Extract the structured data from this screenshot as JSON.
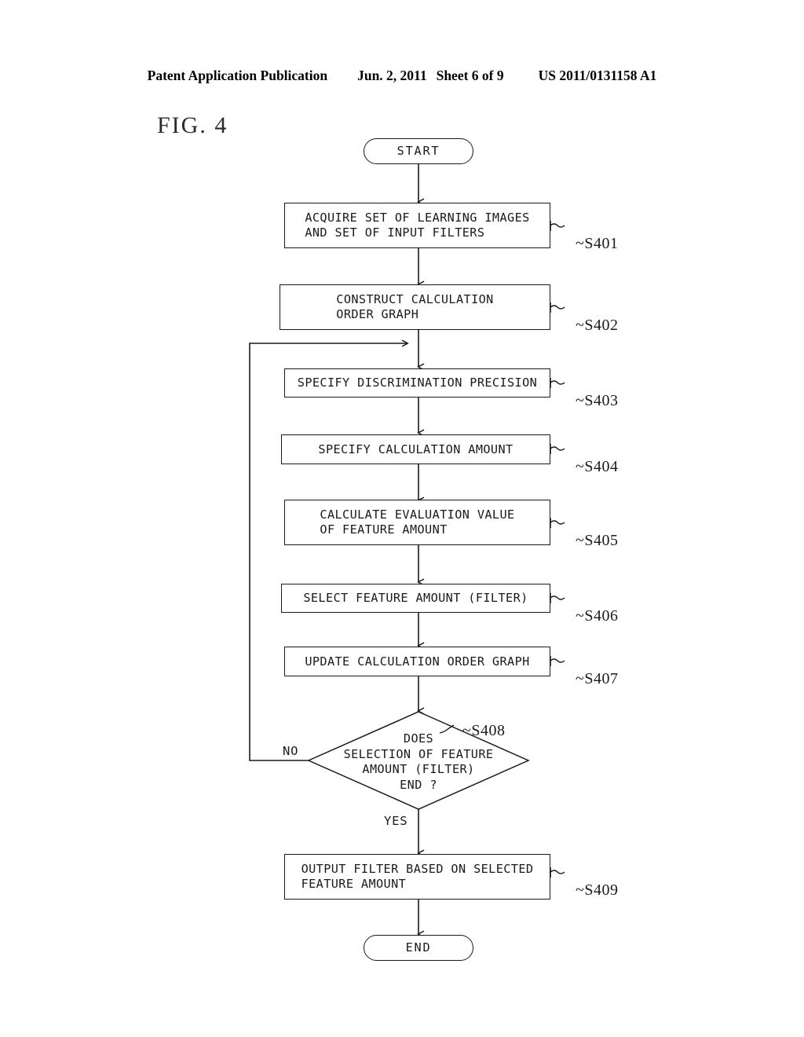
{
  "header": {
    "publication": "Patent Application Publication",
    "date": "Jun. 2, 2011",
    "sheet": "Sheet 6 of 9",
    "number": "US 2011/0131158 A1"
  },
  "figure": {
    "title": "FIG. 4"
  },
  "flowchart": {
    "start": {
      "label": "START"
    },
    "end": {
      "label": "END"
    },
    "steps": [
      {
        "id": "S401",
        "ref": "S401",
        "text": "ACQUIRE SET OF LEARNING IMAGES\nAND SET OF INPUT FILTERS"
      },
      {
        "id": "S402",
        "ref": "S402",
        "text": "CONSTRUCT CALCULATION\nORDER GRAPH"
      },
      {
        "id": "S403",
        "ref": "S403",
        "text": "SPECIFY DISCRIMINATION PRECISION"
      },
      {
        "id": "S404",
        "ref": "S404",
        "text": "SPECIFY CALCULATION AMOUNT"
      },
      {
        "id": "S405",
        "ref": "S405",
        "text": "CALCULATE EVALUATION VALUE\nOF FEATURE AMOUNT"
      },
      {
        "id": "S406",
        "ref": "S406",
        "text": "SELECT FEATURE AMOUNT (FILTER)"
      },
      {
        "id": "S407",
        "ref": "S407",
        "text": "UPDATE CALCULATION ORDER GRAPH"
      },
      {
        "id": "S409",
        "ref": "S409",
        "text": "OUTPUT FILTER BASED ON SELECTED\nFEATURE AMOUNT"
      }
    ],
    "decision": {
      "id": "S408",
      "ref": "S408",
      "text": "DOES\nSELECTION OF FEATURE\nAMOUNT (FILTER)\nEND ?",
      "branch_no": "NO",
      "branch_yes": "YES"
    },
    "tilde": "~",
    "colors": {
      "ink": "#1a1a1a",
      "paper": "#ffffff"
    }
  }
}
